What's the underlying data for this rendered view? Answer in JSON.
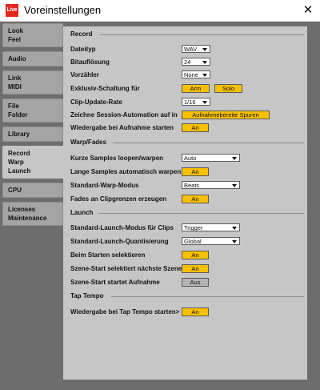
{
  "window": {
    "app_icon_text": "Live",
    "title": "Voreinstellungen",
    "close_glyph": "✕"
  },
  "sidebar": {
    "tabs": [
      {
        "lines": [
          "Look",
          "Feel"
        ]
      },
      {
        "lines": [
          "Audio"
        ]
      },
      {
        "lines": [
          "Link",
          "MIDI"
        ]
      },
      {
        "lines": [
          "File",
          "Folder"
        ]
      },
      {
        "lines": [
          "Library"
        ]
      },
      {
        "lines": [
          "Record",
          "Warp",
          "Launch"
        ],
        "active": true
      },
      {
        "lines": [
          "CPU"
        ]
      },
      {
        "lines": [
          "Licenses",
          "Maintenance"
        ]
      }
    ]
  },
  "record": {
    "heading": "Record",
    "file_type_label": "Dateityp",
    "file_type_value": "WAV",
    "bit_depth_label": "Bitauflösung",
    "bit_depth_value": "24",
    "count_in_label": "Vorzähler",
    "count_in_value": "None",
    "exclusive_label": "Exklusiv-Schaltung für",
    "exclusive_arm": "Arm",
    "exclusive_solo": "Solo",
    "clip_update_label": "Clip-Update-Rate",
    "clip_update_value": "1/16",
    "automation_label": "Zeichne Session-Automation auf in",
    "automation_value": "Aufnahmebereite Spuren",
    "start_playback_label": "Wiedergabe bei Aufnahme starten",
    "start_playback_value": "An"
  },
  "warp": {
    "heading": "Warp/Fades",
    "loop_warp_label": "Kurze Samples loopen/warpen",
    "loop_warp_value": "Auto",
    "auto_warp_label": "Lange Samples automatisch warpen",
    "auto_warp_value": "An",
    "default_mode_label": "Standard-Warp-Modus",
    "default_mode_value": "Beats",
    "fades_label": "Fades an Clipgrenzen erzeugen",
    "fades_value": "An"
  },
  "launch": {
    "heading": "Launch",
    "clip_mode_label": "Standard-Launch-Modus für Clips",
    "clip_mode_value": "Trigger",
    "quantization_label": "Standard-Launch-Quantisierung",
    "quantization_value": "Global",
    "select_on_launch_label": "Beim Starten selektieren",
    "select_on_launch_value": "An",
    "select_next_scene_label": "Szene-Start selektiert nächste Szene",
    "select_next_scene_value": "An",
    "scene_record_label": "Szene-Start startet Aufnahme",
    "scene_record_value": "Aus"
  },
  "tap_tempo": {
    "heading": "Tap Tempo",
    "start_playback_label": "Wiedergabe bei Tap Tempo starten>",
    "start_playback_value": "An"
  },
  "colors": {
    "toggle_on": "#f8c000",
    "toggle_off": "#b3b3b3",
    "panel": "#c6c6c6",
    "frame": "#6d6d6d",
    "icon": "#e5261f"
  }
}
